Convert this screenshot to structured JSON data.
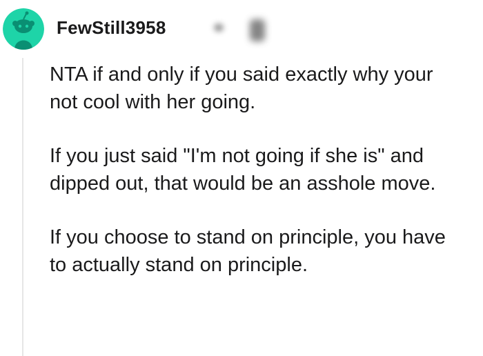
{
  "comment": {
    "author": {
      "username": "FewStill3958",
      "avatar_icon": "snoo-avatar-icon",
      "avatar_bg": "#1ed4a8",
      "avatar_fg": "#0a8f73"
    },
    "paragraphs": [
      "NTA if and only if you said exactly why your not cool with her going.",
      "If you just said \"I'm not going if she is\" and dipped out, that would be an asshole move.",
      "If you choose to stand on principle, you have to actually stand on principle."
    ]
  }
}
